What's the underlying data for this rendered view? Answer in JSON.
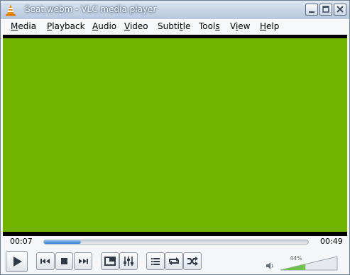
{
  "window": {
    "title": "Seat.webm - VLC media player",
    "app_icon": "vlc-cone-icon",
    "controls": [
      "minimize-icon",
      "maximize-icon",
      "close-icon"
    ]
  },
  "menu": {
    "items": [
      {
        "label": "Media",
        "accel": "M",
        "rest": "edia"
      },
      {
        "label": "Playback",
        "accel": "P",
        "rest": "layback"
      },
      {
        "label": "Audio",
        "accel": "A",
        "rest": "udio"
      },
      {
        "label": "Video",
        "accel": "V",
        "rest": "ideo"
      },
      {
        "label": "Subtitle",
        "pre": "Subti",
        "accel": "t",
        "rest": "le"
      },
      {
        "label": "Tools",
        "pre": "Tool",
        "accel": "s",
        "rest": ""
      },
      {
        "label": "View",
        "pre": "V",
        "accel": "i",
        "rest": "ew"
      },
      {
        "label": "Help",
        "accel": "H",
        "rest": "elp"
      }
    ]
  },
  "video": {
    "color": "#72b500"
  },
  "playback": {
    "elapsed": "00:07",
    "total": "00:49",
    "progress_fraction": 0.14
  },
  "controls": {
    "buttons": [
      "play-icon",
      "previous-icon",
      "stop-icon",
      "next-icon",
      "fullscreen-icon",
      "extended-settings-icon",
      "playlist-icon",
      "loop-icon",
      "shuffle-icon"
    ]
  },
  "volume": {
    "label": "44%",
    "level_fraction": 0.44,
    "icon": "speaker-icon"
  }
}
